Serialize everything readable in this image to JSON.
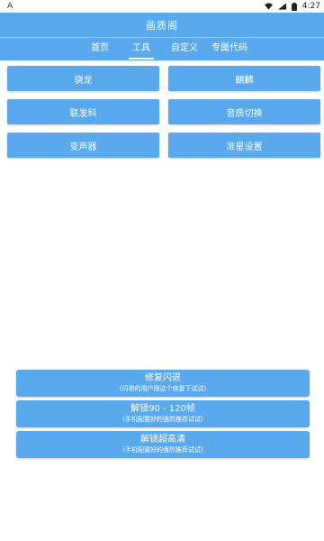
{
  "status": {
    "left_glyph": "A",
    "time": "4:27"
  },
  "header": {
    "title": "画质阁"
  },
  "tabs": [
    "首页",
    "工具",
    "自定义",
    "专属代码"
  ],
  "active_tab": 1,
  "tool_buttons": [
    "骁龙",
    "麒麟",
    "联发科",
    "音质切换",
    "变声器",
    "准星设置"
  ],
  "actions": [
    {
      "label": "修复闪退",
      "sub": "(闪退的用户用这个修复下试试)"
    },
    {
      "label": "解锁90 - 120帧",
      "sub": "(手机配置好的强烈推荐试试)"
    },
    {
      "label": "解锁超高清",
      "sub": "(手机配置好的强烈推荐试试)"
    }
  ],
  "colors": {
    "primary": "#5aa9ee",
    "background": "#ffffff"
  }
}
